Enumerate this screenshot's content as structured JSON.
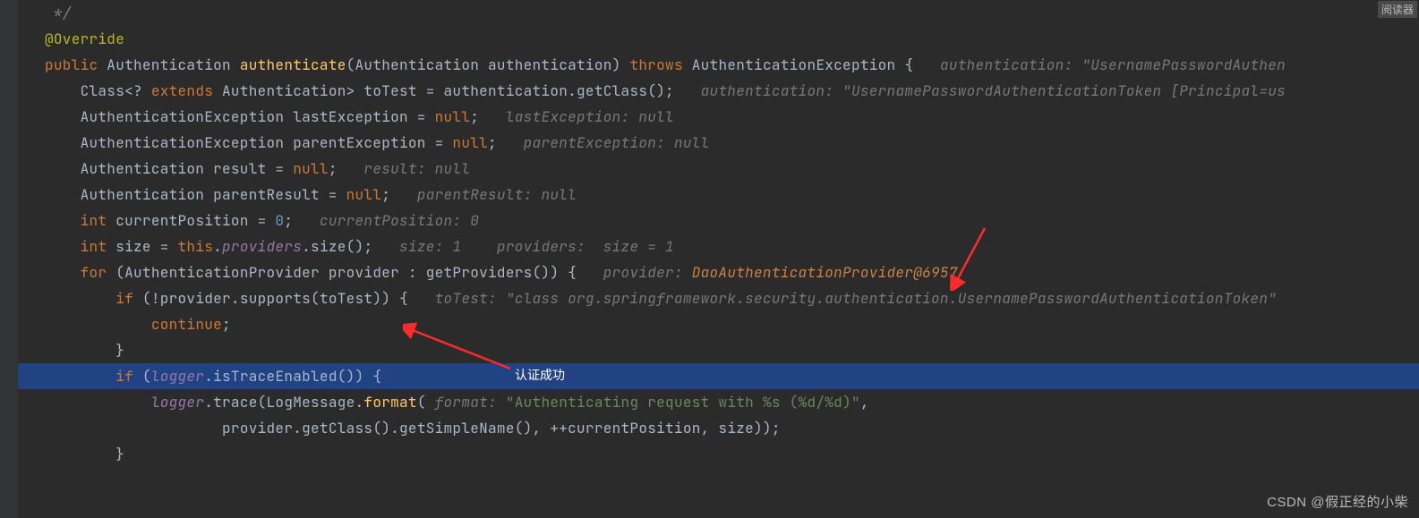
{
  "topBadge": "阅读器",
  "annotation_text": "认证成功",
  "watermark": "CSDN @假正经的小柴",
  "code": {
    "l1_comm": " */",
    "l2_anno": "@Override",
    "l3_kw1": "public",
    "l3_t1": " Authentication ",
    "l3_fn": "authenticate",
    "l3_t2": "(Authentication authentication) ",
    "l3_kw2": "throws",
    "l3_t3": " AuthenticationException {",
    "l3_hint": "   authentication: \"UsernamePasswordAuthen",
    "l4_t1": "Class<? ",
    "l4_kw1": "extends",
    "l4_t2": " Authentication> toTest = authentication.getClass();",
    "l4_hint": "   authentication: \"UsernamePasswordAuthenticationToken [Principal=us",
    "l5_t1": "AuthenticationException lastException = ",
    "l5_kw1": "null",
    "l5_t2": ";",
    "l5_hint": "   lastException: null",
    "l6_t1": "AuthenticationException parentException = ",
    "l6_kw1": "null",
    "l6_t2": ";",
    "l6_hint": "   parentException: null",
    "l7_t1": "Authentication result = ",
    "l7_kw1": "null",
    "l7_t2": ";",
    "l7_hint": "   result: null",
    "l8_t1": "Authentication parentResult = ",
    "l8_kw1": "null",
    "l8_t2": ";",
    "l8_hint": "   parentResult: null",
    "l9_kw1": "int",
    "l9_t1": " currentPosition = ",
    "l9_num": "0",
    "l9_t2": ";",
    "l9_hint": "   currentPosition: 0",
    "l10_kw1": "int",
    "l10_t1": " size = ",
    "l10_kw2": "this",
    "l10_t2": ".",
    "l10_field": "providers",
    "l10_t3": ".size();",
    "l10_hint": "   size: 1    providers:  size = 1",
    "l11_kw1": "for",
    "l11_t1": " (AuthenticationProvider provider : getProviders()) {",
    "l11_hint_k": "   provider: ",
    "l11_hint_v": "DaoAuthenticationProvider@6957",
    "l12_kw1": "if",
    "l12_t1": " (!provider.supports(toTest)) {",
    "l12_hint": "   toTest: \"class org.springframework.security.authentication.UsernamePasswordAuthenticationToken\"",
    "l13_kw1": "continue",
    "l13_t1": ";",
    "l14_t1": "}",
    "l15_kw1": "if",
    "l15_t1": " (",
    "l15_field": "logger",
    "l15_t2": ".isTraceEnabled()) {",
    "l16_field": "logger",
    "l16_t1": ".trace(LogMessage.",
    "l16_fn": "format",
    "l16_t2": "(",
    "l16_hint": " format: ",
    "l16_str": "\"Authenticating request with %s (%d/%d)\"",
    "l16_t3": ",",
    "l17_t1": "provider.getClass().getSimpleName(), ++currentPosition, size));",
    "l18_t1": "}"
  }
}
